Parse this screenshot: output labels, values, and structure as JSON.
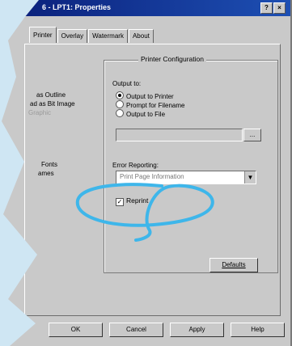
{
  "window": {
    "title": "6 - LPT1: Properties",
    "help_btn": "?",
    "close_btn": "×"
  },
  "tabs": [
    "Printer",
    "Overlay",
    "Watermark",
    "About"
  ],
  "left_labels": {
    "l1": "as Outline",
    "l2": "ad as Bit Image",
    "l3": "Graphic",
    "l4": "Fonts",
    "l5": "ames"
  },
  "printer_config": {
    "group_title": "Printer Configuration",
    "output_to_label": "Output to:",
    "radio_output_printer": "Output to Printer",
    "radio_prompt_filename": "Prompt for Filename",
    "radio_output_file": "Output to File",
    "filename_value": "",
    "browse_label": "...",
    "error_reporting_label": "Error Reporting:",
    "error_reporting_value": "Print Page Information",
    "reprint_label": "Reprint",
    "defaults_label": "Defaults"
  },
  "buttons": {
    "ok": "OK",
    "cancel": "Cancel",
    "apply": "Apply",
    "help": "Help"
  },
  "colors": {
    "annotation": "#3eb6ea",
    "titlebar": "#0a1e78"
  }
}
